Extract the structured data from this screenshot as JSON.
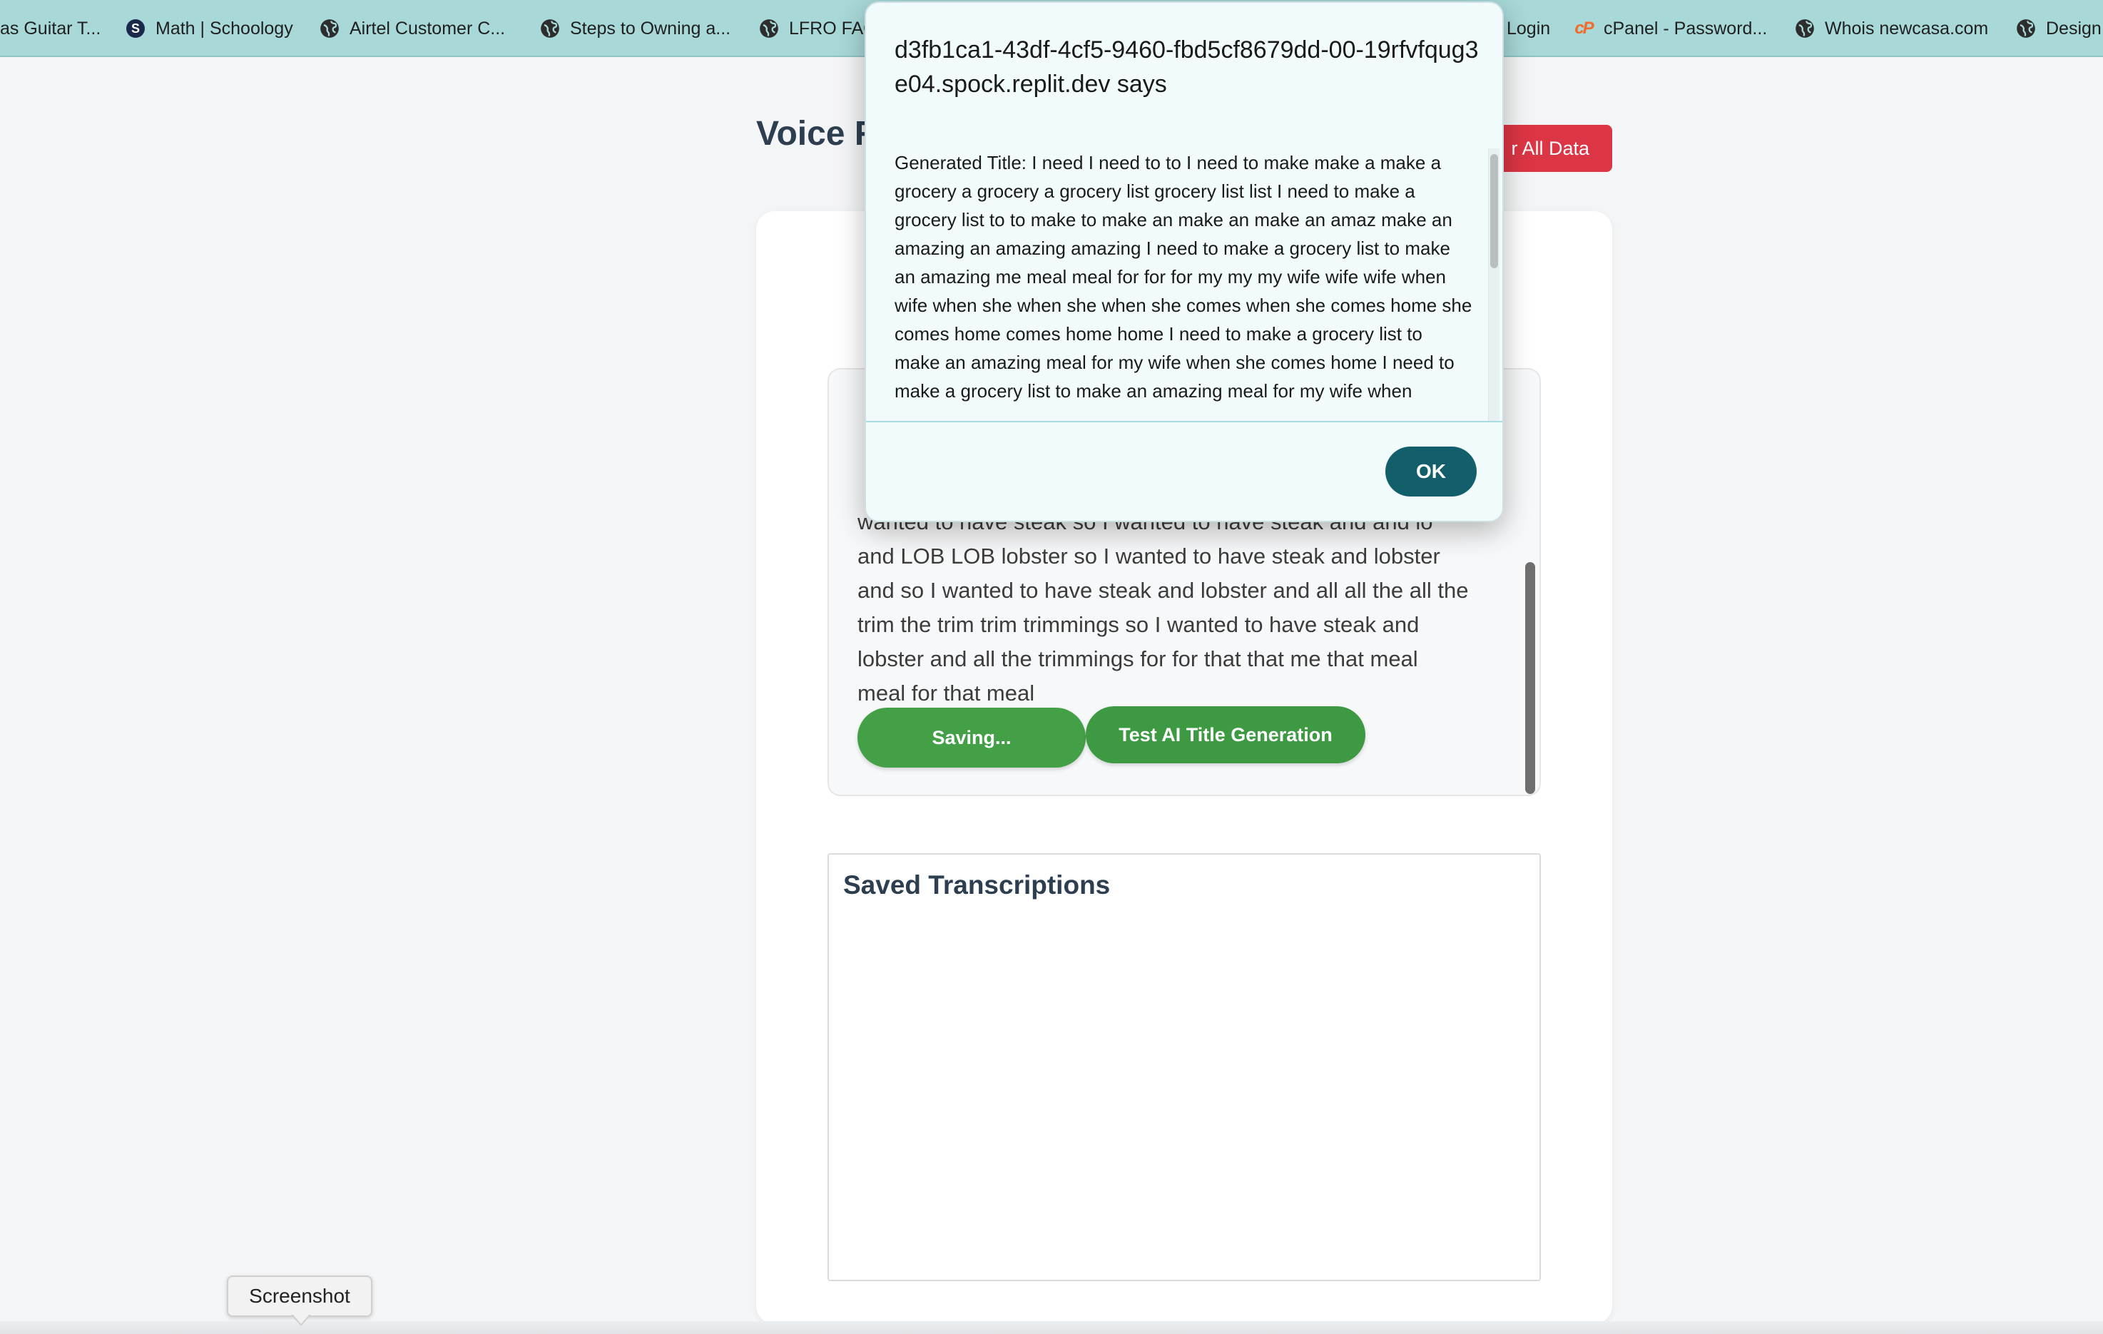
{
  "bookmarks": [
    {
      "label": "as Guitar T...",
      "icon": "globe-icon"
    },
    {
      "label": "Math | Schoology",
      "icon": "schoology-icon"
    },
    {
      "label": "Airtel Customer C...",
      "icon": "globe-icon"
    },
    {
      "label": "Steps to Owning a...",
      "icon": "globe-icon"
    },
    {
      "label": "LFRO FAQ",
      "icon": "globe-icon"
    },
    {
      "label": "Login",
      "icon": "globe-icon"
    },
    {
      "label": "cPanel - Password...",
      "icon": "cpanel-icon"
    },
    {
      "label": "Whois newcasa.com",
      "icon": "globe-icon"
    },
    {
      "label": "Design",
      "icon": "globe-icon"
    }
  ],
  "page": {
    "title": "Voice R",
    "clear_button": "r All Data"
  },
  "transcript": {
    "text": "wanted to have steak so I wanted to have steak and and lo and LOB LOB lobster so I wanted to have steak and lobster and so I wanted to have steak and lobster and all all the all the trim the trim trim trimmings so I wanted to have steak and lobster and all the trimmings for for that that me that meal meal for that meal"
  },
  "buttons": {
    "saving": "Saving...",
    "test_ai": "Test AI Title Generation"
  },
  "saved": {
    "title": "Saved Transcriptions"
  },
  "dialog": {
    "origin": "d3fb1ca1-43df-4cf5-9460-fbd5cf8679dd-00-19rfvfqug3e04.spock.replit.dev says",
    "message": "Generated Title:  I need I need to  to I need to  make  make a make a grocery  a grocery  a grocery list  grocery list  list I need to make a grocery list  to  to make  to make an  make an  make an amaz  make an amazing  an amazing  amazing I need to make a grocery list to make an amazing  me  meal  meal for  for for my  my  my wife  wife  wife when  wife when she  when she when she comes  when she comes home  she comes home comes home  home I need to make a grocery list to make an amazing meal for my wife when she comes home I need to make a grocery list to make an amazing meal for my wife when",
    "ok": "OK"
  },
  "tooltip": {
    "label": "Screenshot"
  },
  "colors": {
    "bookmarks_bar": "#a8d8d8",
    "danger": "#dc3545",
    "green": "#43a047",
    "ok_button": "#135e6b"
  }
}
